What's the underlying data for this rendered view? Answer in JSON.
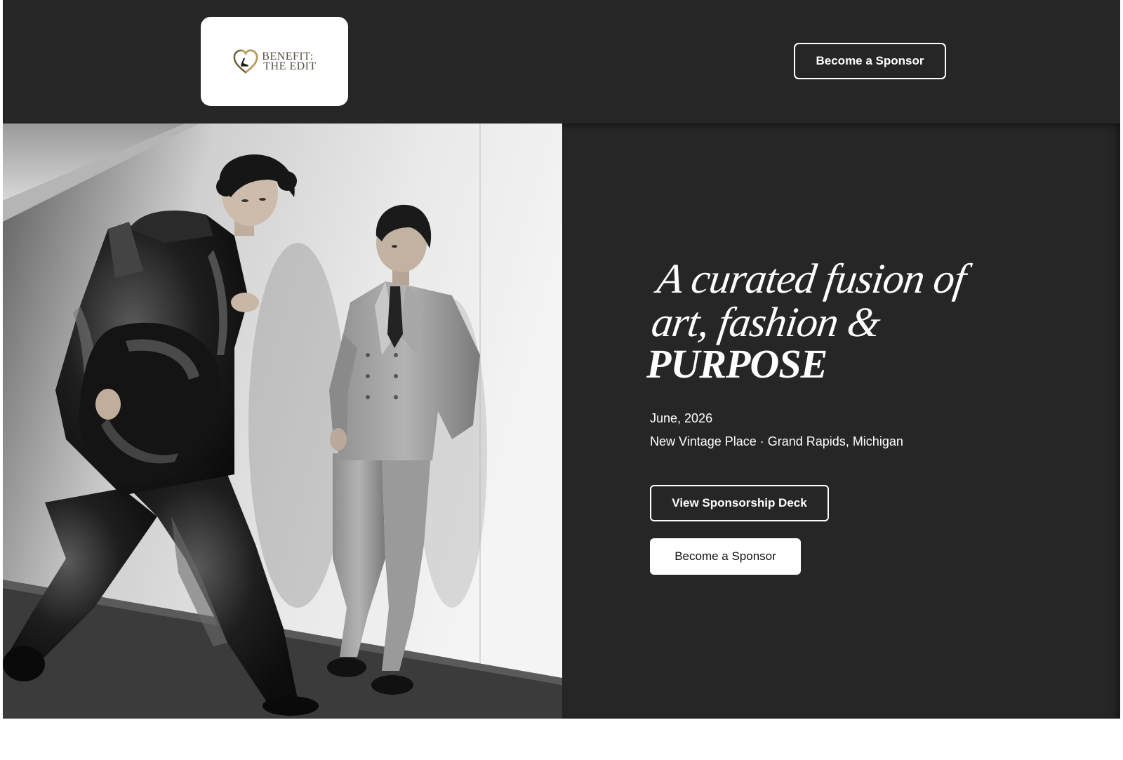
{
  "header": {
    "logo": {
      "line1": "BENEFIT:",
      "line2": "THE EDIT",
      "icon": "heart-with-heel-icon"
    },
    "cta_label": "Become a Sponsor"
  },
  "hero": {
    "photo": {
      "description_icon": "fashion-photo",
      "style": "black-and-white"
    },
    "headline": {
      "line1": "A curated fusion of",
      "line2": "art, fashion &",
      "line3": "PURPOSE"
    },
    "date": "June, 2026",
    "location": "New Vintage Place · Grand Rapids, Michigan",
    "buttons": {
      "deck_label": "View Sponsorship Deck",
      "sponsor_label": "Become a Sponsor"
    }
  },
  "colors": {
    "header_bg": "#262626",
    "hero_bg": "#262626",
    "text_on_dark": "#ffffff",
    "logo_text": "#5a5144"
  }
}
